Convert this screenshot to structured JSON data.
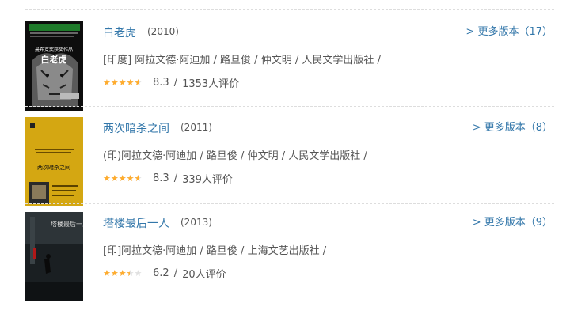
{
  "books": [
    {
      "title": "白老虎",
      "year": "(2010)",
      "more": "> 更多版本（17）",
      "meta": "[印度] 阿拉文德·阿迪加 / 路旦俊 / 仲文明 / 人民文学出版社 /",
      "rating": 0.83,
      "score": "8.3",
      "sep": "/",
      "count": "1353人评价",
      "cover_title": "白老虎",
      "cover_sub": "曼布克奖获奖作品"
    },
    {
      "title": "两次暗杀之间",
      "year": "(2011)",
      "more": "> 更多版本（8）",
      "meta": "(印)阿拉文德·阿迪加 / 路旦俊 / 仲文明 / 人民文学出版社 /",
      "rating": 0.83,
      "score": "8.3",
      "sep": "/",
      "count": "339人评价",
      "cover_title": "两次暗杀之间"
    },
    {
      "title": "塔楼最后一人",
      "year": "(2013)",
      "more": "> 更多版本（9）",
      "meta": "[印]阿拉文德·阿迪加 / 路旦俊 / 上海文艺出版社 /",
      "rating": 0.62,
      "score": "6.2",
      "sep": "/",
      "count": "20人评价",
      "cover_title": "塔楼最后一人"
    }
  ],
  "colors": {
    "link": "#3377aa",
    "star": "#ffac2d",
    "star_empty": "#e0e0e0",
    "cover2_bg": "#d4a712"
  }
}
